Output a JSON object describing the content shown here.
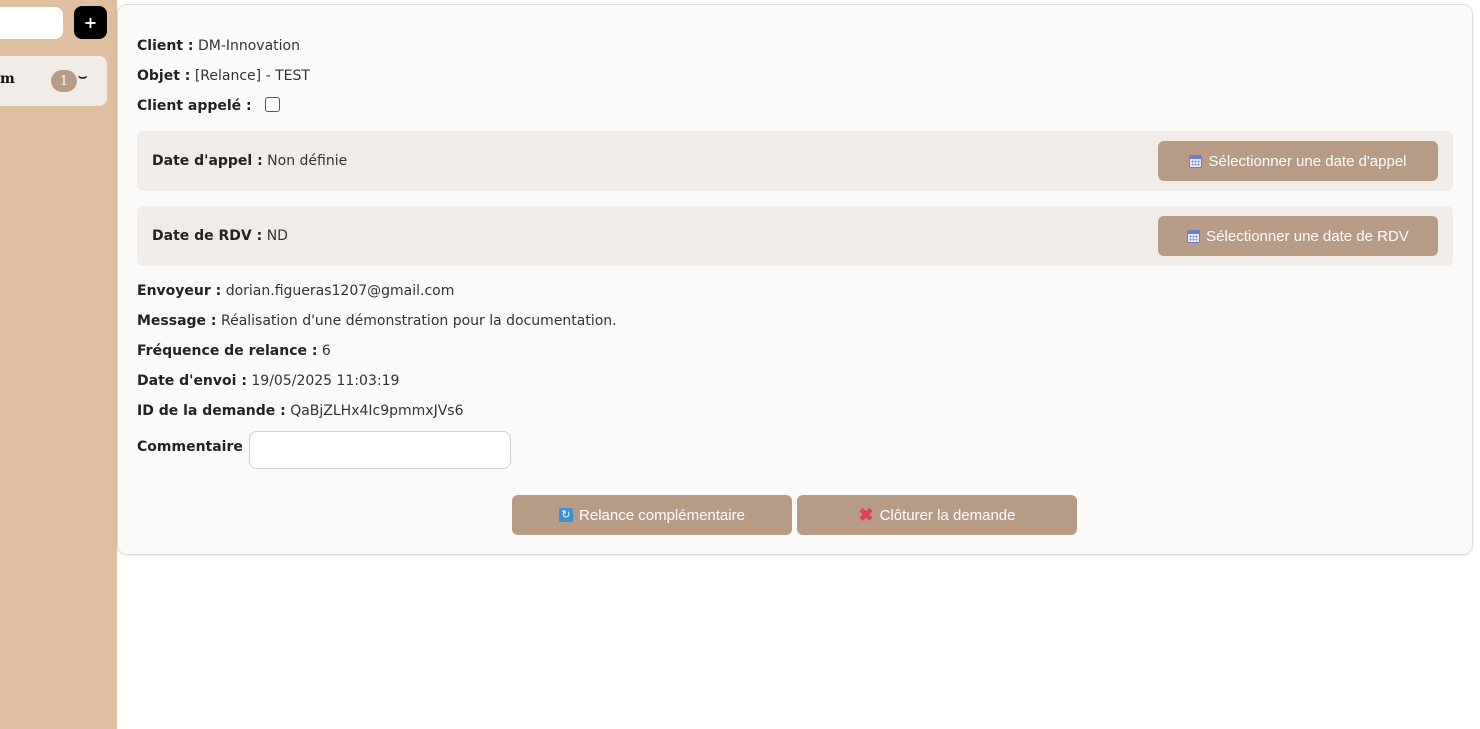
{
  "sidebar": {
    "search_placeholder": "",
    "add_label": "+",
    "item": {
      "label": "m",
      "count": "1",
      "chevron": "⌣"
    }
  },
  "detail": {
    "client_label": "Client :",
    "client_value": "DM-Innovation",
    "objet_label": "Objet :",
    "objet_value": "[Relance] - TEST",
    "client_appele_label": "Client appelé :",
    "date_appel_label": "Date d'appel :",
    "date_appel_value": "Non définie",
    "select_date_appel_label": "Sélectionner une date d'appel",
    "date_rdv_label": "Date de RDV :",
    "date_rdv_value": "ND",
    "select_date_rdv_label": "Sélectionner une date de RDV",
    "envoyeur_label": "Envoyeur :",
    "envoyeur_value": "dorian.figueras1207@gmail.com",
    "message_label": "Message :",
    "message_value": "Réalisation d'une démonstration pour la documentation.",
    "frequence_label": "Fréquence de relance :",
    "frequence_value": "6",
    "date_envoi_label": "Date d'envoi :",
    "date_envoi_value": "19/05/2025 11:03:19",
    "id_label": "ID de la demande :",
    "id_value": "QaBjZLHx4Ic9pmmxJVs6",
    "commentaire_label": "Commentaire :",
    "commentaire_value": "",
    "relance_label": "Relance complémentaire",
    "cloturer_label": "Clôturer la demande"
  },
  "icons": {
    "calendar": "calendar-icon",
    "refresh": "refresh-icon",
    "close": "close-icon"
  },
  "colors": {
    "sidebar_bg": "#dfbf9f",
    "button_bg": "#b89b84",
    "panel_bg": "#f1ece7"
  }
}
